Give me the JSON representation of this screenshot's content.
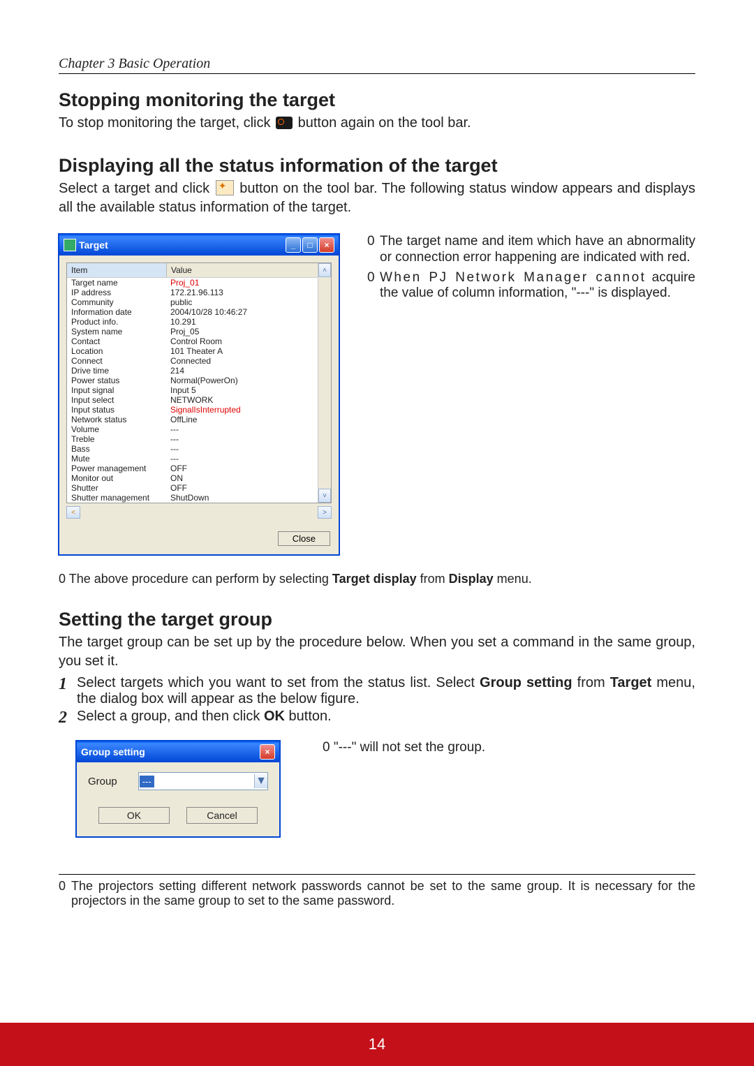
{
  "chapter": "Chapter 3 Basic Operation",
  "h_stop": "Stopping monitoring the target",
  "p_stop_a": "To stop monitoring the target, click ",
  "p_stop_b": " button again on the tool bar.",
  "h_disp": "Displaying all the status information of the target",
  "p_disp_a": "Select a target and click ",
  "p_disp_b": " button on the tool bar. The following status window appears and displays all the available status information of the target.",
  "target_window": {
    "title": "Target",
    "col_item": "Item",
    "col_value": "Value",
    "rows": [
      {
        "item": "Target name",
        "value": "Proj_01",
        "red": true
      },
      {
        "item": "IP address",
        "value": "172.21.96.113"
      },
      {
        "item": "Community",
        "value": "public"
      },
      {
        "item": "Information date",
        "value": "2004/10/28 10:46:27"
      },
      {
        "item": "Product info.",
        "value": "10.291"
      },
      {
        "item": "System name",
        "value": "Proj_05"
      },
      {
        "item": "Contact",
        "value": "Control Room"
      },
      {
        "item": "Location",
        "value": "101 Theater A"
      },
      {
        "item": "Connect",
        "value": "Connected"
      },
      {
        "item": "Drive time",
        "value": "214"
      },
      {
        "item": "Power status",
        "value": "Normal(PowerOn)"
      },
      {
        "item": "Input signal",
        "value": "Input 5"
      },
      {
        "item": "Input select",
        "value": "NETWORK"
      },
      {
        "item": "Input status",
        "value": "SignalIsInterrupted",
        "red": true
      },
      {
        "item": "Network status",
        "value": "OffLine"
      },
      {
        "item": "Volume",
        "value": "---"
      },
      {
        "item": "Treble",
        "value": "---"
      },
      {
        "item": "Bass",
        "value": "---"
      },
      {
        "item": "Mute",
        "value": "---"
      },
      {
        "item": "Power management",
        "value": "OFF"
      },
      {
        "item": "Monitor out",
        "value": "ON"
      },
      {
        "item": "Shutter",
        "value": "OFF"
      },
      {
        "item": "Shutter management",
        "value": "ShutDown"
      }
    ],
    "close": "Close"
  },
  "side_notes": {
    "n1": "The target name and item which have an abnormality or connection error happening are indicated with red.",
    "n2a": "When PJ Network Manager cannot",
    "n2b": " acquire the value of column information, \"---\" is displayed."
  },
  "body_note_pre": "The above procedure can perform by selecting ",
  "body_note_bold1": "Target display",
  "body_note_mid": " from ",
  "body_note_bold2": "Display",
  "body_note_post": " menu.",
  "h_group": "Setting the target group",
  "p_group": "The target group can be set up by the procedure below. When you set a command in the same group, you set it.",
  "step1_a": "Select targets which you want to set from the status list. Select ",
  "step1_bold1": "Group setting",
  "step1_b": " from ",
  "step1_bold2": "Target",
  "step1_c": " menu, the dialog box will appear as the below figure.",
  "step2_a": "Select a group, and then click ",
  "step2_bold": "OK",
  "step2_b": " button.",
  "group_window": {
    "title": "Group setting",
    "label": "Group",
    "value": "---",
    "ok": "OK",
    "cancel": "Cancel"
  },
  "group_note": "\"---\" will not set the group.",
  "footer_note": "The projectors setting different network passwords cannot be set to the same group. It is necessary for the projectors in the same group to set to the same password.",
  "page_number": "14",
  "marker": "0"
}
